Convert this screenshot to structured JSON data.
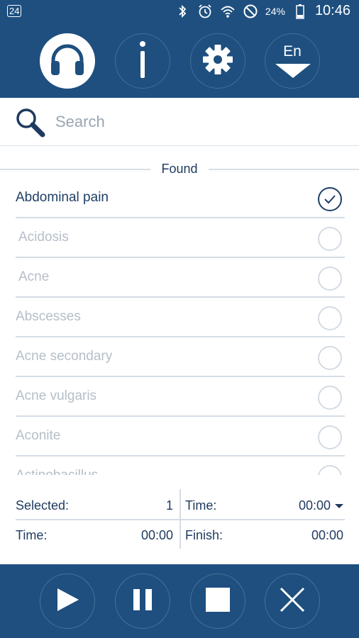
{
  "status_bar": {
    "left_badge": "24",
    "battery": "24%",
    "time": "10:46",
    "icons": [
      "bluetooth-icon",
      "alarm-icon",
      "wifi-icon",
      "do-not-disturb-icon",
      "battery-icon"
    ]
  },
  "toolbar": {
    "buttons": [
      "headphones-icon",
      "info-icon",
      "gear-icon",
      "language-dropdown"
    ],
    "language": "En",
    "active_color": "#ffffff",
    "bar_color": "#1e4f7f"
  },
  "search": {
    "placeholder": "Search",
    "value": ""
  },
  "list": {
    "header": "Found",
    "items": [
      {
        "label": "Abdominal pain",
        "selected": true
      },
      {
        "label": "Acidosis",
        "selected": false
      },
      {
        "label": "Acne",
        "selected": false
      },
      {
        "label": "Abscesses",
        "selected": false
      },
      {
        "label": "Acne secondary",
        "selected": false
      },
      {
        "label": "Acne vulgaris",
        "selected": false
      },
      {
        "label": "Aconite",
        "selected": false
      },
      {
        "label": "Actinobacillus",
        "selected": false
      }
    ]
  },
  "stats": {
    "selected_label": "Selected:",
    "selected_value": "1",
    "time_label": "Time:",
    "time_value": "00:00",
    "elapsed_label": "Time:",
    "elapsed_value": "00:00",
    "finish_label": "Finish:",
    "finish_value": "00:00"
  },
  "player": {
    "buttons": [
      "play-icon",
      "pause-icon",
      "stop-icon",
      "close-icon"
    ]
  }
}
